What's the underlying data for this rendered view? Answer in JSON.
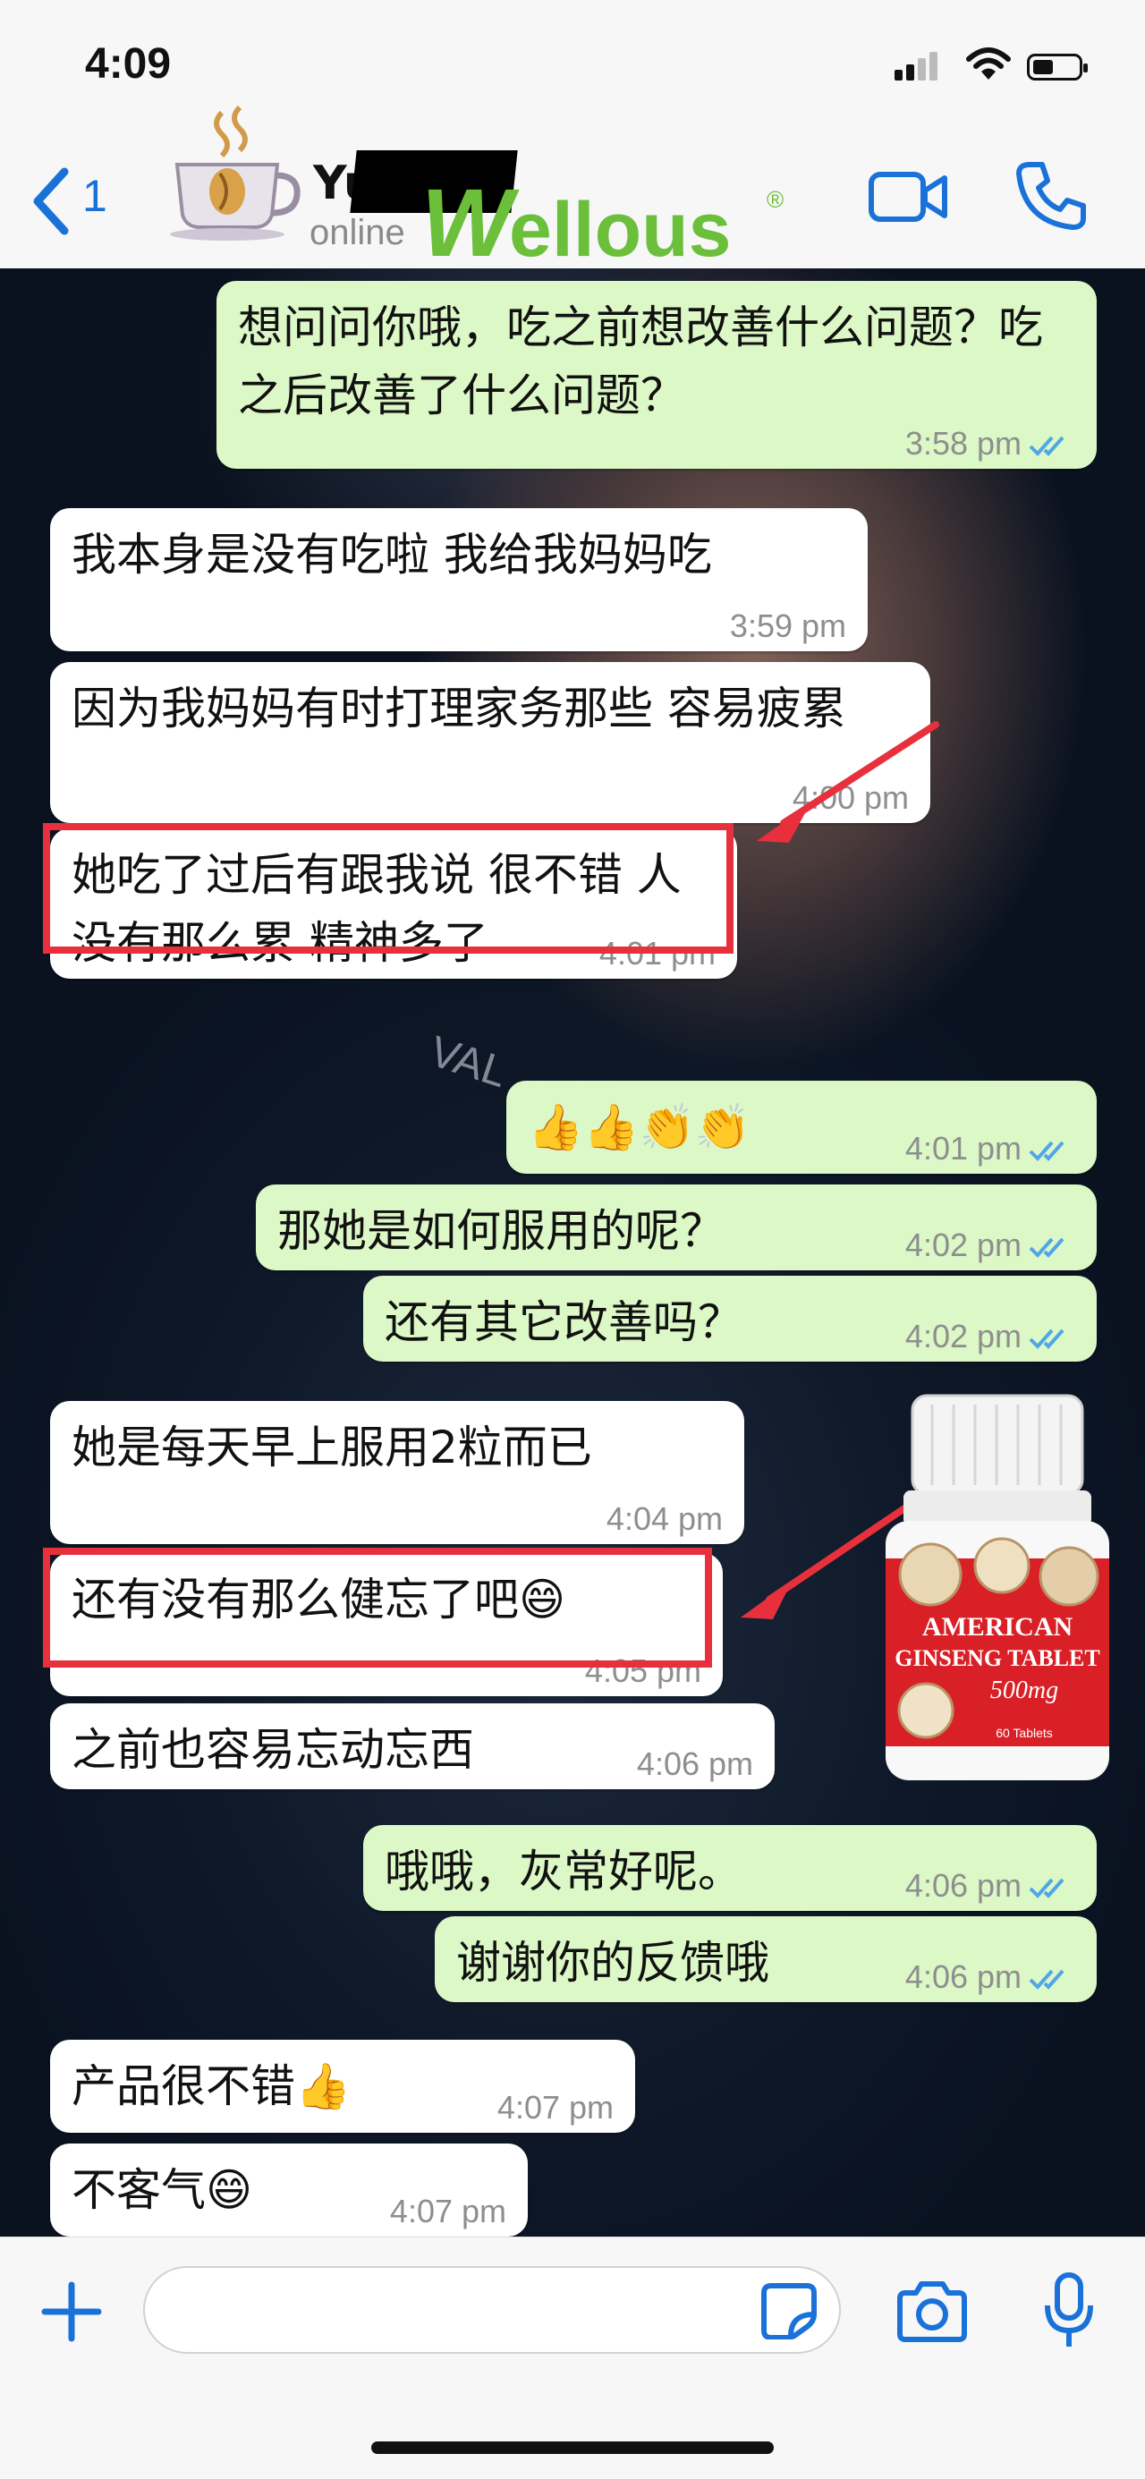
{
  "status_bar": {
    "time": "4:09"
  },
  "header": {
    "back_count": "1",
    "contact_name": "Yu",
    "presence": "online",
    "brand": "Wellous",
    "brand_mark": "®"
  },
  "messages": [
    {
      "dir": "out",
      "text": "想问问你哦，吃之前想改善什么问题？吃之后改善了什么问题？",
      "time": "3:58 pm",
      "read": true
    },
    {
      "dir": "in",
      "text": "我本身是没有吃啦 我给我妈妈吃",
      "time": "3:59 pm"
    },
    {
      "dir": "in",
      "text": "因为我妈妈有时打理家务那些 容易疲累",
      "time": "4:00 pm"
    },
    {
      "dir": "in",
      "text": "她吃了过后有跟我说 很不错 人没有那么累 精神多了",
      "time": "4:01 pm",
      "highlighted": true
    },
    {
      "dir": "out",
      "text": "👍👍👏👏",
      "time": "4:01 pm",
      "read": true
    },
    {
      "dir": "out",
      "text": "那她是如何服用的呢？",
      "time": "4:02 pm",
      "read": true
    },
    {
      "dir": "out",
      "text": "还有其它改善吗？",
      "time": "4:02 pm",
      "read": true
    },
    {
      "dir": "in",
      "text": "她是每天早上服用2粒而已",
      "time": "4:04 pm"
    },
    {
      "dir": "in",
      "text": "还有没有那么健忘了吧😄",
      "time": "4:05 pm",
      "highlighted": true
    },
    {
      "dir": "in",
      "text": "之前也容易忘动忘西",
      "time": "4:06 pm"
    },
    {
      "dir": "out",
      "text": "哦哦，灰常好呢。",
      "time": "4:06 pm",
      "read": true
    },
    {
      "dir": "out",
      "text": "谢谢你的反馈哦",
      "time": "4:06 pm",
      "read": true
    },
    {
      "dir": "in",
      "text": "产品很不错👍",
      "time": "4:07 pm"
    },
    {
      "dir": "in",
      "text": "不客气😄",
      "time": "4:07 pm"
    }
  ],
  "background_watermark": "VAL",
  "product": {
    "line1": "AMERICAN",
    "line2": "GINSENG TABLET",
    "dose": "500mg",
    "count": "60 Tablets"
  },
  "colors": {
    "outgoing_bubble": "#dcf8c6",
    "incoming_bubble": "#ffffff",
    "accent_blue": "#1a72d9",
    "highlight_red": "#e8303d",
    "brand_green": "#6bbf3a",
    "read_tick": "#4fa6e8"
  },
  "icons": [
    "back-chevron-icon",
    "coffee-cup-icon",
    "video-call-icon",
    "phone-icon",
    "read-receipt-icon",
    "plus-icon",
    "sticker-icon",
    "camera-icon",
    "microphone-icon"
  ]
}
